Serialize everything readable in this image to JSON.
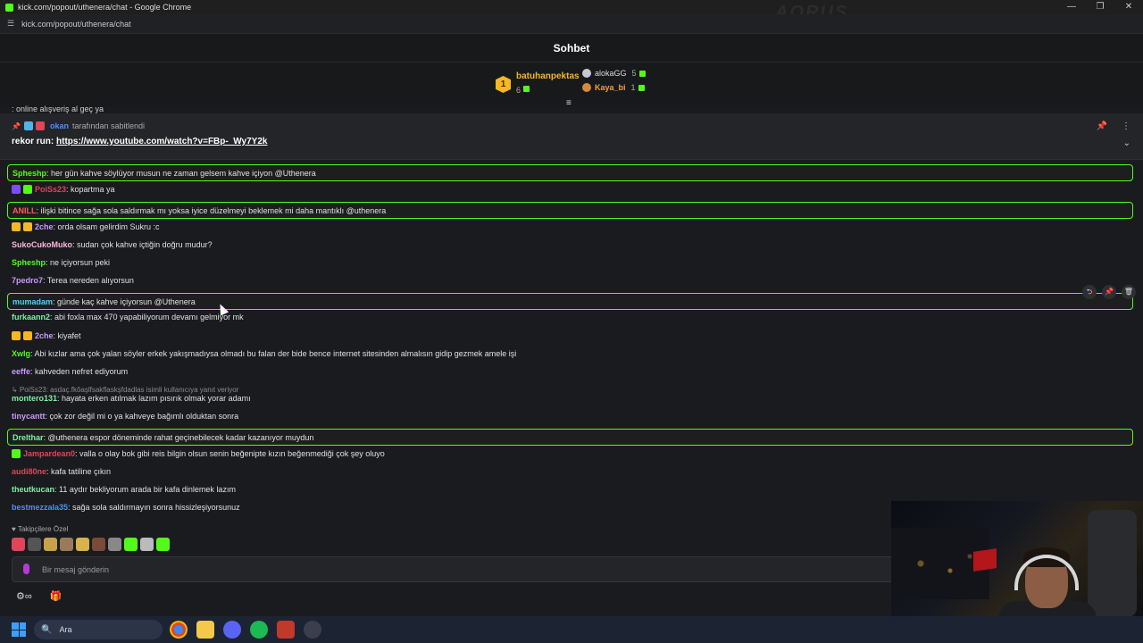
{
  "window": {
    "title": "kick.com/popout/uthenera/chat - Google Chrome",
    "url": "kick.com/popout/uthenera/chat",
    "controls": [
      "—",
      "❐",
      "✕"
    ],
    "watermark": "AORUS"
  },
  "header": {
    "title": "Sohbet"
  },
  "leaderboard": {
    "first": {
      "rank": "1",
      "name": "batuhanpektas",
      "count": "6"
    },
    "second": {
      "name": "alokaGG",
      "count": "5"
    },
    "third": {
      "name": "Kaya_bi",
      "count": "1"
    },
    "expand_icon": "≡"
  },
  "partial_message": ": online alışveriş al geç ya",
  "pinned": {
    "pinned_by_user": "okan",
    "pinned_by_text": "tarafından sabitlendi",
    "text_prefix": "rekor run: ",
    "link": "https://www.youtube.com/watch?v=FBp-_Wy7Y2k",
    "pin_icon": "📌",
    "menu_icon": "⋮",
    "chevron_icon": "⌄"
  },
  "messages": [
    {
      "user": "Spheshp",
      "color": "#53fc18",
      "text": ": her gün kahve söylüyor musun ne zaman gelsem kahve içiyon @Uthenera",
      "highlight": true,
      "badges": []
    },
    {
      "user": "PoiSs23",
      "color": "#e0455a",
      "text": ": kopartma ya",
      "highlight": false,
      "badges": [
        "#7c4dff",
        "#53fc18"
      ]
    },
    {
      "user": "ANILL",
      "color": "#ff5a5a",
      "text": ": ilişki bitince sağa sola saldırmak mı yoksa iyice düzelmeyi beklemek mi daha mantıklı @uthenera",
      "highlight": true,
      "badges": []
    },
    {
      "user": "2che",
      "color": "#c89bff",
      "text": ": orda olsam gelirdim Sukru :c",
      "highlight": false,
      "badges": [
        "#f5b823",
        "#f5b823"
      ]
    },
    {
      "user": "SukoCukoMuko",
      "color": "#ffb7e1",
      "text": ": sudan çok kahve içtiğin doğru mudur?",
      "highlight": false,
      "badges": []
    },
    {
      "user": "Spheshp",
      "color": "#53fc18",
      "text": ": ne içiyorsun peki",
      "highlight": false,
      "badges": []
    },
    {
      "user": "7pedro7",
      "color": "#c89bff",
      "text": ": Terea nereden alıyorsun",
      "highlight": false,
      "badges": []
    },
    {
      "user": "mumadam",
      "color": "#53d3fc",
      "text": ": günde kaç kahve içiyorsun @Uthenera",
      "highlight": true,
      "badges": []
    },
    {
      "user": "furkaann2",
      "color": "#7ef0a8",
      "text": ": abi foxla max 470 yapabiliyorum devamı gelmiyor mk",
      "highlight": false,
      "badges": []
    },
    {
      "user": "2che",
      "color": "#c89bff",
      "text": ": kiyafet",
      "highlight": false,
      "badges": [
        "#f5b823",
        "#f5b823"
      ]
    },
    {
      "user": "Xwlg",
      "color": "#53fc18",
      "text": ": Abi kızlar ama çok yalan söyler erkek yakışmadıysa olmadı bu falan der bide bence internet sitesinden almalısın gidip gezmek amele işi",
      "highlight": false,
      "badges": []
    },
    {
      "user": "eeffe",
      "color": "#c89bff",
      "text": ": kahveden nefret ediyorum",
      "highlight": false,
      "badges": []
    },
    {
      "user": "montero131",
      "color": "#7ef0a8",
      "text": ": hayata erken atılmak lazım pısırık olmak yorar adamı",
      "highlight": false,
      "badges": []
    },
    {
      "user": "tinycantt",
      "color": "#c89bff",
      "text": ": çok zor değil mi o ya kahveye bağımlı olduktan sonra",
      "highlight": false,
      "badges": []
    },
    {
      "user": "Drelthar",
      "color": "#7ef0a8",
      "text": ": @uthenera espor döneminde rahat geçinebilecek kadar kazanıyor muydun",
      "highlight": true,
      "badges": []
    },
    {
      "user": "Jampardean0",
      "color": "#e0455a",
      "text": ": valla o olay bok gibi reis bilgin olsun senin beğenipte kızın beğenmediği çok şey oluyo",
      "highlight": false,
      "badges": [
        "#53fc18"
      ]
    },
    {
      "user": "audi80ne",
      "color": "#e0455a",
      "text": ": kafa tatiline çıkın",
      "highlight": false,
      "badges": []
    },
    {
      "user": "theutkucan",
      "color": "#7ef0a8",
      "text": ": 11 aydır bekliyorum arada bir kafa dinlemek lazım",
      "highlight": false,
      "badges": []
    },
    {
      "user": "bestmezzala35",
      "color": "#4f8ff7",
      "text": ": sağa sola saldırmayın sonra hissizleşiyorsunuz",
      "highlight": false,
      "badges": []
    }
  ],
  "reply_preview": "↳ PoiSs23: asdaç.fkôaşlfsakflaskşfdadlas isimli kullanıcıya yanıt veriyor",
  "hover_tools": [
    "⮌",
    "📌",
    "🗑"
  ],
  "followers_label": "♥ Takipçilere Özel",
  "input": {
    "placeholder": "Bir mesaj gönderin"
  },
  "bottom_icons": [
    "⚙∞",
    "🎁"
  ],
  "taskbar": {
    "search_label": "Ara",
    "search_icon": "🔍"
  }
}
